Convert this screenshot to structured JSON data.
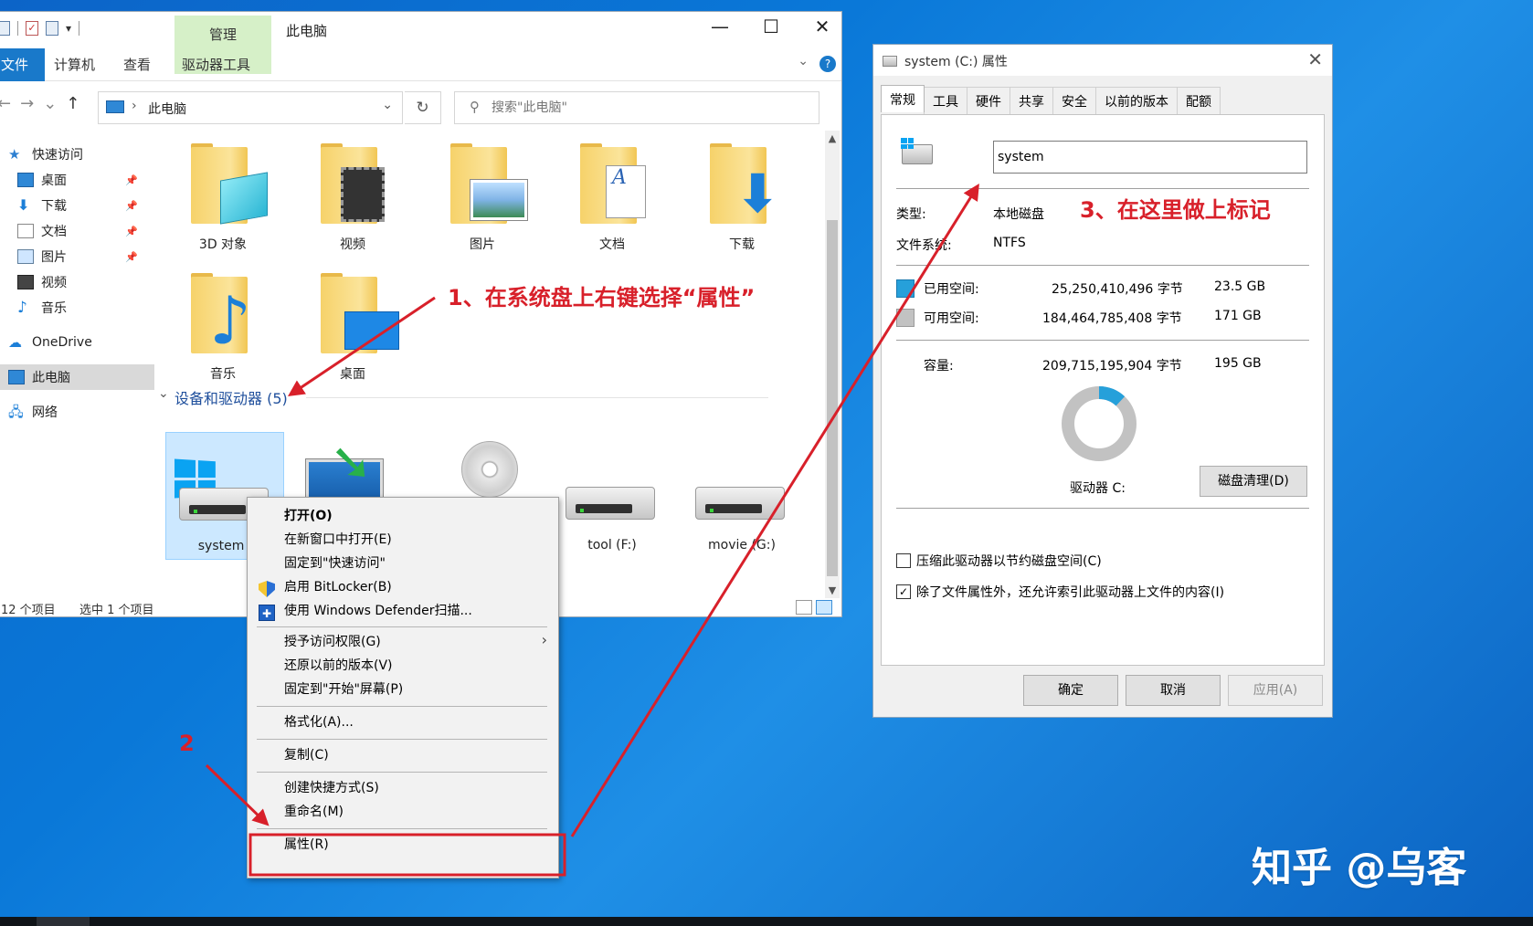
{
  "explorer": {
    "ribbon_manage": "管理",
    "window_title": "此电脑",
    "win_controls": {
      "minimize": "—",
      "maximize": "☐",
      "close": "✕"
    },
    "ribbon_tabs": {
      "file": "文件",
      "computer": "计算机",
      "view": "查看",
      "drive_tools": "驱动器工具"
    },
    "help": "?",
    "address": "此电脑",
    "search_placeholder": "搜索\"此电脑\"",
    "sidebar": {
      "quick_access": "快速访问",
      "desktop": "桌面",
      "downloads": "下载",
      "documents": "文档",
      "pictures": "图片",
      "videos": "视频",
      "music": "音乐",
      "onedrive": "OneDrive",
      "this_pc": "此电脑",
      "network": "网络"
    },
    "folders": {
      "objects3d": "3D 对象",
      "videos": "视频",
      "pictures": "图片",
      "documents": "文档",
      "downloads": "下载",
      "music": "音乐",
      "desktop": "桌面"
    },
    "section_title": "设备和驱动器 (5)",
    "drives": {
      "system": "system (",
      "tool": "tool (F:)",
      "movie": "movie (G:)"
    },
    "status": {
      "count": "12 个项目",
      "selected": "选中 1 个项目"
    }
  },
  "context_menu": {
    "open": "打开(O)",
    "open_new_window": "在新窗口中打开(E)",
    "pin_quick": "固定到\"快速访问\"",
    "bitlocker": "启用 BitLocker(B)",
    "defender": "使用 Windows Defender扫描...",
    "grant_access": "授予访问权限(G)",
    "restore_versions": "还原以前的版本(V)",
    "pin_start": "固定到\"开始\"屏幕(P)",
    "format": "格式化(A)...",
    "copy": "复制(C)",
    "create_shortcut": "创建快捷方式(S)",
    "rename": "重命名(M)",
    "properties": "属性(R)"
  },
  "properties": {
    "title": "system (C:) 属性",
    "tabs": [
      "常规",
      "工具",
      "硬件",
      "共享",
      "安全",
      "以前的版本",
      "配额"
    ],
    "name_value": "system",
    "type_label": "类型:",
    "type_value": "本地磁盘",
    "fs_label": "文件系统:",
    "fs_value": "NTFS",
    "used_label": "已用空间:",
    "used_bytes": "25,250,410,496 字节",
    "used_gb": "23.5 GB",
    "free_label": "可用空间:",
    "free_bytes": "184,464,785,408 字节",
    "free_gb": "171 GB",
    "cap_label": "容量:",
    "cap_bytes": "209,715,195,904 字节",
    "cap_gb": "195 GB",
    "used_fraction": 0.12,
    "drive_label": "驱动器 C:",
    "cleanup": "磁盘清理(D)",
    "compress": "压缩此驱动器以节约磁盘空间(C)",
    "index": "除了文件属性外，还允许索引此驱动器上文件的内容(I)",
    "ok": "确定",
    "cancel": "取消",
    "apply": "应用(A)",
    "colors": {
      "used": "#26a0da",
      "free": "#c2c2c2"
    }
  },
  "annotations": {
    "step1": "1、在系统盘上右键选择“属性”",
    "step2": "2",
    "step3": "3、在这里做上标记",
    "color": "#d8202a"
  },
  "watermark": "知乎 @乌客"
}
